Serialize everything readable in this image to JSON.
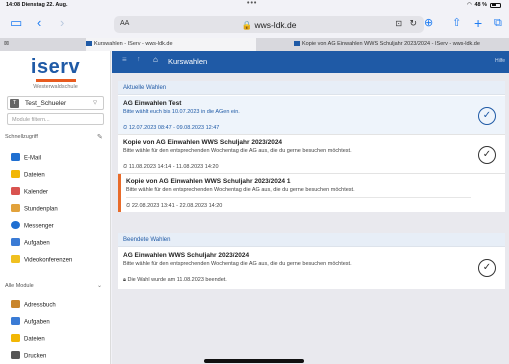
{
  "status": {
    "time": "14:08  Dienstag 22. Aug.",
    "dots": "•••",
    "battery": "48 %"
  },
  "toolbar": {
    "aa": "AA",
    "url": "wws-ldk.de"
  },
  "tabs": [
    {
      "title": "Kurswahlen - IServ - wws-ldk.de"
    },
    {
      "title": "Kopie von AG Einwahlen WWS Schuljahr 2023/2024 - IServ - wws-ldk.de"
    }
  ],
  "sidebar": {
    "logo": "iserv",
    "school": "Westerwaldschule",
    "user": {
      "initial": "T",
      "name": "Test_Schueler"
    },
    "search_placeholder": "Module filtern...",
    "quick_label": "Schnellzugriff",
    "quick_items": [
      {
        "label": "E-Mail",
        "color": "#1f6fd1"
      },
      {
        "label": "Dateien",
        "color": "#f2b705"
      },
      {
        "label": "Kalender",
        "color": "#d9534f"
      },
      {
        "label": "Stundenplan",
        "color": "#e2a23b"
      },
      {
        "label": "Messenger",
        "color": "#1f6fd1"
      },
      {
        "label": "Aufgaben",
        "color": "#3a7bd5"
      },
      {
        "label": "Videokonferenzen",
        "color": "#f0c020"
      }
    ],
    "all_label": "Alle Module",
    "all_items": [
      {
        "label": "Adressbuch",
        "color": "#c9852a"
      },
      {
        "label": "Aufgaben",
        "color": "#3a7bd5"
      },
      {
        "label": "Dateien",
        "color": "#f2b705"
      },
      {
        "label": "Drucken",
        "color": "#555555"
      }
    ]
  },
  "main": {
    "title": "Kurswahlen",
    "help": "Hilfe",
    "current": {
      "header": "Aktuelle Wahlen",
      "items": [
        {
          "title": "AG Einwahlen Test",
          "desc": "Bitte wählt euch bis 10.07.2023 in die AGen ein.",
          "meta": "12.07.2023 08:47 - 09.08.2023 12:47"
        },
        {
          "title": "Kopie von AG Einwahlen WWS Schuljahr 2023/2024",
          "desc": "Bitte wähle für den entsprechenden Wochentag die AG aus, die du gerne besuchen möchtest.",
          "meta": "11.08.2023 14:14 - 11.08.2023 14:20"
        },
        {
          "title": "Kopie von AG Einwahlen WWS Schuljahr 2023/2024 1",
          "desc": "Bitte wähle für den entsprechenden Wochentag die AG aus, die du gerne besuchen möchtest.",
          "meta": "22.08.2023 13:41 - 22.08.2023 14:20"
        }
      ]
    },
    "finished": {
      "header": "Beendete Wahlen",
      "items": [
        {
          "title": "AG Einwahlen WWS Schuljahr 2023/2024",
          "desc": "Bitte wähle für den entsprechenden Wochentag die AG aus, die du gerne besuchen möchtest.",
          "meta": "Die Wahl wurde am 11.08.2023 beendet."
        }
      ]
    }
  }
}
